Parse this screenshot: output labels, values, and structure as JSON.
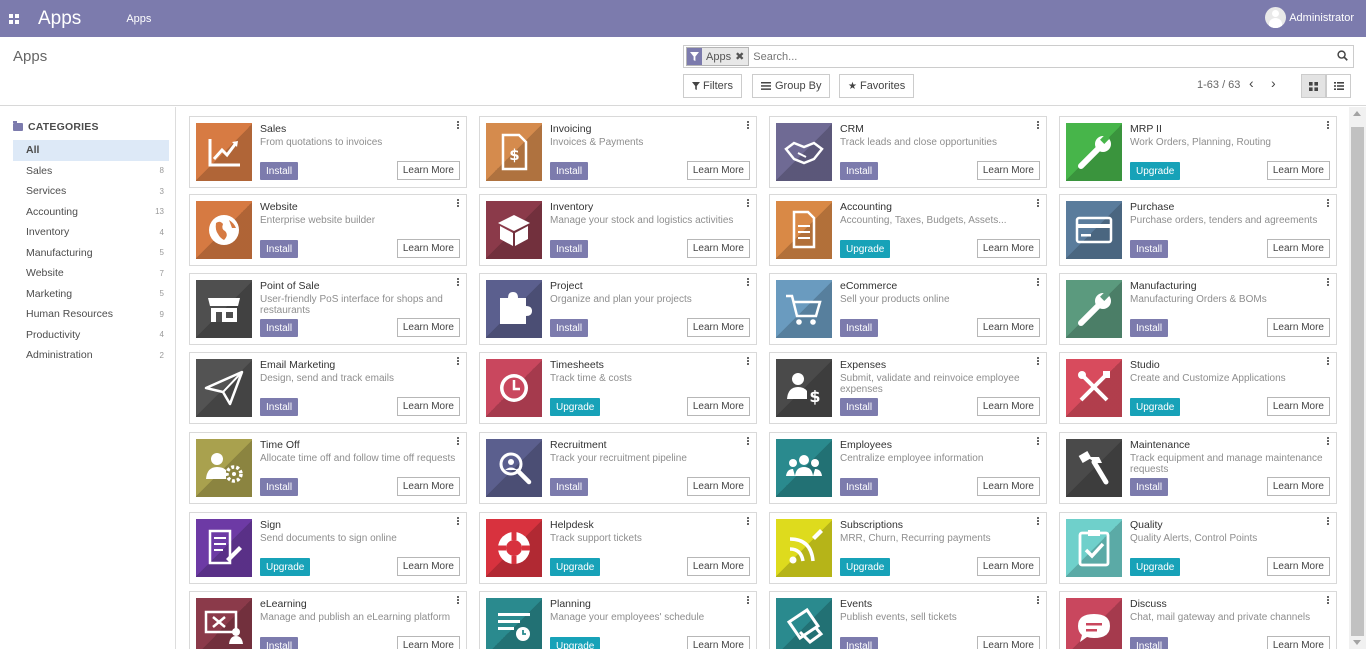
{
  "navbar": {
    "brand": "Apps",
    "menu_item": "Apps",
    "user_name": "Administrator",
    "color": "#7c7bad"
  },
  "control_panel": {
    "title": "Apps",
    "search": {
      "facet_label": "Apps",
      "placeholder": "Search..."
    },
    "filters_label": "Filters",
    "group_by_label": "Group By",
    "favorites_label": "Favorites",
    "pager": "1-63 / 63"
  },
  "sidebar": {
    "heading": "CATEGORIES",
    "items": [
      {
        "label": "All",
        "count": ""
      },
      {
        "label": "Sales",
        "count": "8"
      },
      {
        "label": "Services",
        "count": "3"
      },
      {
        "label": "Accounting",
        "count": "13"
      },
      {
        "label": "Inventory",
        "count": "4"
      },
      {
        "label": "Manufacturing",
        "count": "5"
      },
      {
        "label": "Website",
        "count": "7"
      },
      {
        "label": "Marketing",
        "count": "5"
      },
      {
        "label": "Human Resources",
        "count": "9"
      },
      {
        "label": "Productivity",
        "count": "4"
      },
      {
        "label": "Administration",
        "count": "2"
      }
    ]
  },
  "colors": {
    "install": "#7c7bad",
    "upgrade": "#17a2b8",
    "active_category": "#dde9f7"
  },
  "apps": [
    {
      "name": "Sales",
      "summary": "From quotations to invoices",
      "action": "Install",
      "learn": "Learn More",
      "icon": "chart-line-icon",
      "color": "#d77b43"
    },
    {
      "name": "Invoicing",
      "summary": "Invoices & Payments",
      "action": "Install",
      "learn": "Learn More",
      "icon": "invoice-dollar-icon",
      "color": "#d58b4d"
    },
    {
      "name": "CRM",
      "summary": "Track leads and close opportunities",
      "action": "Install",
      "learn": "Learn More",
      "icon": "handshake-icon",
      "color": "#6f6a94"
    },
    {
      "name": "MRP II",
      "summary": "Work Orders, Planning, Routing",
      "action": "Upgrade",
      "learn": "Learn More",
      "icon": "wrench-icon",
      "color": "#47b54a"
    },
    {
      "name": "Website",
      "summary": "Enterprise website builder",
      "action": "Install",
      "learn": "Learn More",
      "icon": "globe-icon",
      "color": "#d67a42"
    },
    {
      "name": "Inventory",
      "summary": "Manage your stock and logistics activities",
      "action": "Install",
      "learn": "Learn More",
      "icon": "box-icon",
      "color": "#8b3a4a"
    },
    {
      "name": "Accounting",
      "summary": "Accounting, Taxes, Budgets, Assets...",
      "action": "Upgrade",
      "learn": "Learn More",
      "icon": "document-icon",
      "color": "#d98946"
    },
    {
      "name": "Purchase",
      "summary": "Purchase orders, tenders and agreements",
      "action": "Install",
      "learn": "Learn More",
      "icon": "credit-card-icon",
      "color": "#5a7c9c"
    },
    {
      "name": "Point of Sale",
      "summary": "User-friendly PoS interface for shops and restaurants",
      "action": "Install",
      "learn": "Learn More",
      "icon": "store-icon",
      "color": "#4f4f4f"
    },
    {
      "name": "Project",
      "summary": "Organize and plan your projects",
      "action": "Install",
      "learn": "Learn More",
      "icon": "puzzle-icon",
      "color": "#5b5f8e"
    },
    {
      "name": "eCommerce",
      "summary": "Sell your products online",
      "action": "Install",
      "learn": "Learn More",
      "icon": "cart-icon",
      "color": "#6a9bbf"
    },
    {
      "name": "Manufacturing",
      "summary": "Manufacturing Orders & BOMs",
      "action": "Install",
      "learn": "Learn More",
      "icon": "wrench-icon",
      "color": "#5b9a7e"
    },
    {
      "name": "Email Marketing",
      "summary": "Design, send and track emails",
      "action": "Install",
      "learn": "Learn More",
      "icon": "paper-plane-icon",
      "color": "#535353"
    },
    {
      "name": "Timesheets",
      "summary": "Track time & costs",
      "action": "Upgrade",
      "learn": "Learn More",
      "icon": "clock-icon",
      "color": "#c9475e"
    },
    {
      "name": "Expenses",
      "summary": "Submit, validate and reinvoice employee expenses",
      "action": "Install",
      "learn": "Learn More",
      "icon": "user-dollar-icon",
      "color": "#4a4a4a"
    },
    {
      "name": "Studio",
      "summary": "Create and Customize Applications",
      "action": "Upgrade",
      "learn": "Learn More",
      "icon": "tools-icon",
      "color": "#d84b5d"
    },
    {
      "name": "Time Off",
      "summary": "Allocate time off and follow time off requests",
      "action": "Install",
      "learn": "Learn More",
      "icon": "user-gear-icon",
      "color": "#a9a14e"
    },
    {
      "name": "Recruitment",
      "summary": "Track your recruitment pipeline",
      "action": "Install",
      "learn": "Learn More",
      "icon": "magnifier-icon",
      "color": "#5b5f8e"
    },
    {
      "name": "Employees",
      "summary": "Centralize employee information",
      "action": "Install",
      "learn": "Learn More",
      "icon": "users-icon",
      "color": "#2a8a8e"
    },
    {
      "name": "Maintenance",
      "summary": "Track equipment and manage maintenance requests",
      "action": "Install",
      "learn": "Learn More",
      "icon": "hammer-icon",
      "color": "#4a4a4a"
    },
    {
      "name": "Sign",
      "summary": "Send documents to sign online",
      "action": "Upgrade",
      "learn": "Learn More",
      "icon": "sign-document-icon",
      "color": "#6d3aa5"
    },
    {
      "name": "Helpdesk",
      "summary": "Track support tickets",
      "action": "Upgrade",
      "learn": "Learn More",
      "icon": "lifebuoy-icon",
      "color": "#d8323e"
    },
    {
      "name": "Subscriptions",
      "summary": "MRR, Churn, Recurring payments",
      "action": "Upgrade",
      "learn": "Learn More",
      "icon": "rss-icon",
      "color": "#dedb1d"
    },
    {
      "name": "Quality",
      "summary": "Quality Alerts, Control Points",
      "action": "Upgrade",
      "learn": "Learn More",
      "icon": "clipboard-check-icon",
      "color": "#6fd0cb"
    },
    {
      "name": "eLearning",
      "summary": "Manage and publish an eLearning platform",
      "action": "Install",
      "learn": "Learn More",
      "icon": "presentation-icon",
      "color": "#8b3a4a"
    },
    {
      "name": "Planning",
      "summary": "Manage your employees' schedule",
      "action": "Upgrade",
      "learn": "Learn More",
      "icon": "planning-icon",
      "color": "#2a8a8e"
    },
    {
      "name": "Events",
      "summary": "Publish events, sell tickets",
      "action": "Install",
      "learn": "Learn More",
      "icon": "ticket-icon",
      "color": "#2a8a8e"
    },
    {
      "name": "Discuss",
      "summary": "Chat, mail gateway and private channels",
      "action": "Install",
      "learn": "Learn More",
      "icon": "chat-bubble-icon",
      "color": "#c9475e"
    }
  ]
}
